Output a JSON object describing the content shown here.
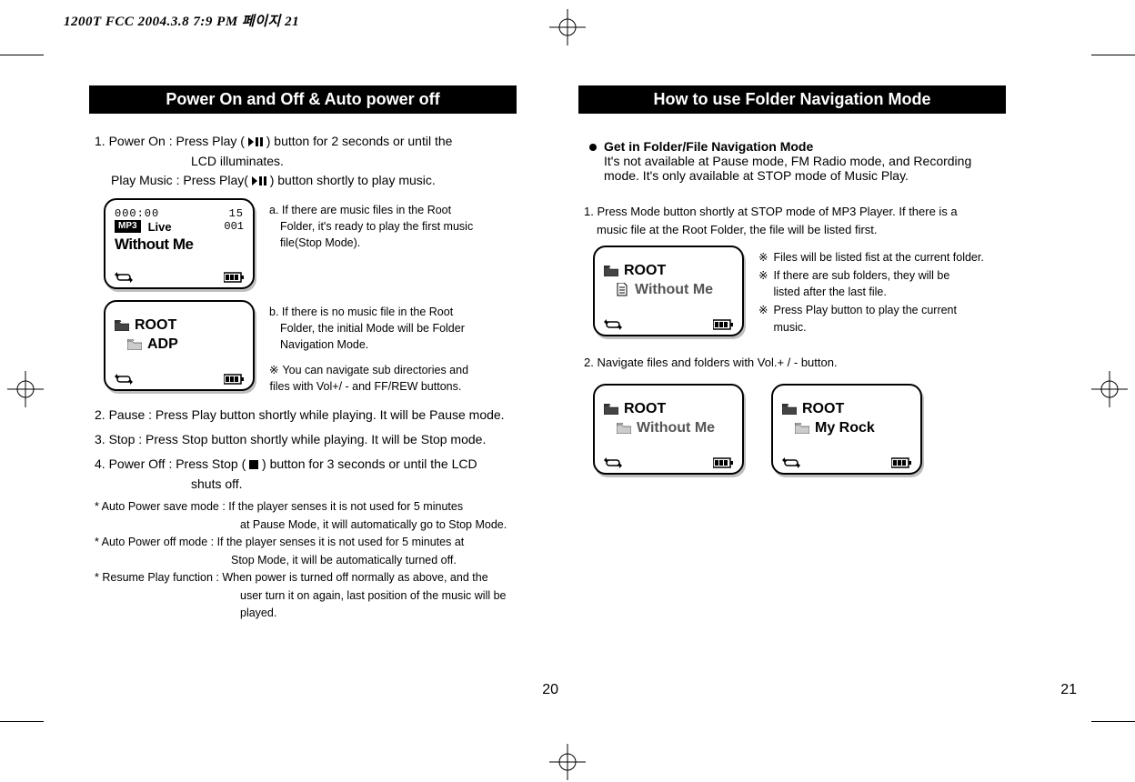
{
  "header": {
    "print_mark": "1200T FCC  2004.3.8 7:9 PM  페이지 21"
  },
  "left_page": {
    "title": "Power On and Off & Auto power off",
    "p1_a": "1. Power On : Press Play (",
    "p1_b": ") button for 2 seconds or until the",
    "p1_c": "LCD illuminates.",
    "p1_play_a": "Play Music : Press Play(",
    "p1_play_b": ") button shortly to play music.",
    "lcd1": {
      "time": "000:00",
      "track_total": "15",
      "badge": "MP3",
      "live": "Live",
      "track": "001",
      "song": "Without Me"
    },
    "note_a1": "a. If there are music files in the Root",
    "note_a2": "Folder, it's ready to play the first music",
    "note_a3": "file(Stop Mode).",
    "lcd2": {
      "root": "ROOT",
      "sub": "ADP"
    },
    "note_b1": "b. If there is no music file in the Root",
    "note_b2": "Folder, the initial Mode will be Folder",
    "note_b3": "Navigation Mode.",
    "note_b_extra1": "You can navigate sub directories and",
    "note_b_extra2": "files with Vol+/ - and FF/REW buttons.",
    "p2": "2. Pause : Press Play button shortly while playing. It will be Pause mode.",
    "p3": "3. Stop : Press Stop button shortly while playing. It will be Stop mode.",
    "p4_a": "4. Power Off : Press Stop (",
    "p4_b": ") button for 3 seconds or until the LCD",
    "p4_c": "shuts off.",
    "autosave1": "* Auto Power save mode : If the player senses it is not used for 5 minutes",
    "autosave2": "at Pause Mode, it will automatically go to Stop Mode.",
    "autooff1": "* Auto Power off mode : If the player senses it is not used for 5 minutes at",
    "autooff2": "Stop Mode, it will be automatically turned off.",
    "resume1": "* Resume Play function : When power is turned off normally as above, and the",
    "resume2": "user turn it on again,  last position of the music will be",
    "resume3": "played.",
    "page_number": "20"
  },
  "right_page": {
    "title": "How to use Folder Navigation Mode",
    "bullet_head": "Get in Folder/File Navigation Mode",
    "bullet_body1": "It's not available at Pause mode, FM Radio mode, and Recording",
    "bullet_body2": "mode. It's only available at STOP mode of Music Play.",
    "step1a": "1. Press Mode button shortly at STOP mode of MP3 Player. If there is a",
    "step1b": "music file at the Root Folder, the file will be listed first.",
    "lcd3": {
      "root": "ROOT",
      "file": "Without Me"
    },
    "notes": {
      "n1": "Files will be listed fist at the current folder.",
      "n2a": "If there are sub folders, they will be",
      "n2b": "listed after the last file.",
      "n3a": "Press Play button to play the current",
      "n3b": "music."
    },
    "step2": "2. Navigate files and folders with Vol.+ / - button.",
    "lcd4": {
      "root": "ROOT",
      "file": "Without Me"
    },
    "lcd5": {
      "root": "ROOT",
      "folder": "My Rock"
    },
    "page_number": "21"
  }
}
